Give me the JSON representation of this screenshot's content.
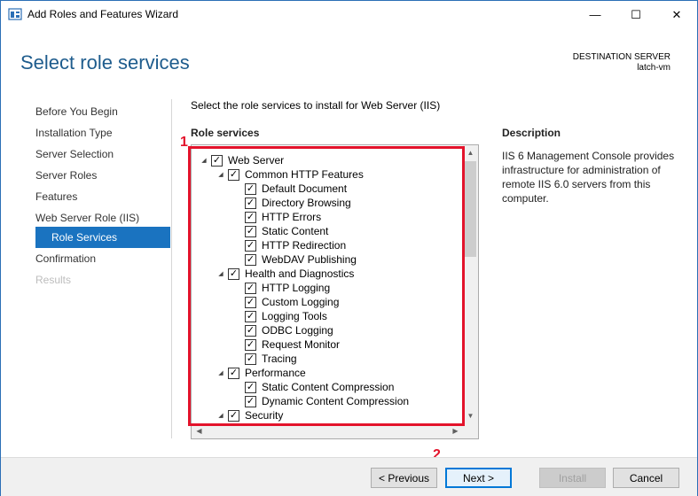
{
  "window": {
    "title": "Add Roles and Features Wizard",
    "minimize_glyph": "—",
    "maximize_glyph": "☐",
    "close_glyph": "✕"
  },
  "header": {
    "page_title": "Select role services",
    "destination_label": "DESTINATION SERVER",
    "destination_name": "latch-vm"
  },
  "nav": {
    "items": [
      {
        "label": "Before You Begin",
        "state": "normal"
      },
      {
        "label": "Installation Type",
        "state": "normal"
      },
      {
        "label": "Server Selection",
        "state": "normal"
      },
      {
        "label": "Server Roles",
        "state": "normal"
      },
      {
        "label": "Features",
        "state": "normal"
      },
      {
        "label": "Web Server Role (IIS)",
        "state": "normal"
      },
      {
        "label": "Role Services",
        "state": "active"
      },
      {
        "label": "Confirmation",
        "state": "normal"
      },
      {
        "label": "Results",
        "state": "disabled"
      }
    ]
  },
  "main": {
    "instruction": "Select the role services to install for Web Server (IIS)",
    "role_services_heading": "Role services",
    "description_heading": "Description",
    "description_text": "IIS 6 Management Console provides infrastructure for administration of remote IIS 6.0 servers from this computer.",
    "tree": [
      {
        "label": "Web Server",
        "level": 0,
        "expandable": true,
        "checked": true
      },
      {
        "label": "Common HTTP Features",
        "level": 1,
        "expandable": true,
        "checked": true
      },
      {
        "label": "Default Document",
        "level": 2,
        "expandable": false,
        "checked": true
      },
      {
        "label": "Directory Browsing",
        "level": 2,
        "expandable": false,
        "checked": true
      },
      {
        "label": "HTTP Errors",
        "level": 2,
        "expandable": false,
        "checked": true
      },
      {
        "label": "Static Content",
        "level": 2,
        "expandable": false,
        "checked": true
      },
      {
        "label": "HTTP Redirection",
        "level": 2,
        "expandable": false,
        "checked": true
      },
      {
        "label": "WebDAV Publishing",
        "level": 2,
        "expandable": false,
        "checked": true
      },
      {
        "label": "Health and Diagnostics",
        "level": 1,
        "expandable": true,
        "checked": true
      },
      {
        "label": "HTTP Logging",
        "level": 2,
        "expandable": false,
        "checked": true
      },
      {
        "label": "Custom Logging",
        "level": 2,
        "expandable": false,
        "checked": true
      },
      {
        "label": "Logging Tools",
        "level": 2,
        "expandable": false,
        "checked": true
      },
      {
        "label": "ODBC Logging",
        "level": 2,
        "expandable": false,
        "checked": true
      },
      {
        "label": "Request Monitor",
        "level": 2,
        "expandable": false,
        "checked": true
      },
      {
        "label": "Tracing",
        "level": 2,
        "expandable": false,
        "checked": true
      },
      {
        "label": "Performance",
        "level": 1,
        "expandable": true,
        "checked": true
      },
      {
        "label": "Static Content Compression",
        "level": 2,
        "expandable": false,
        "checked": true
      },
      {
        "label": "Dynamic Content Compression",
        "level": 2,
        "expandable": false,
        "checked": true
      },
      {
        "label": "Security",
        "level": 1,
        "expandable": true,
        "checked": true
      }
    ],
    "expander_glyph": "◢",
    "check_glyph": "✓"
  },
  "annotations": {
    "marker_1": "1",
    "marker_2": "2"
  },
  "footer": {
    "previous_label": "< Previous",
    "next_label": "Next >",
    "install_label": "Install",
    "cancel_label": "Cancel"
  },
  "colors": {
    "title_blue": "#1e5c8d",
    "active_nav": "#1a73c0",
    "annotation_red": "#e3132b"
  }
}
